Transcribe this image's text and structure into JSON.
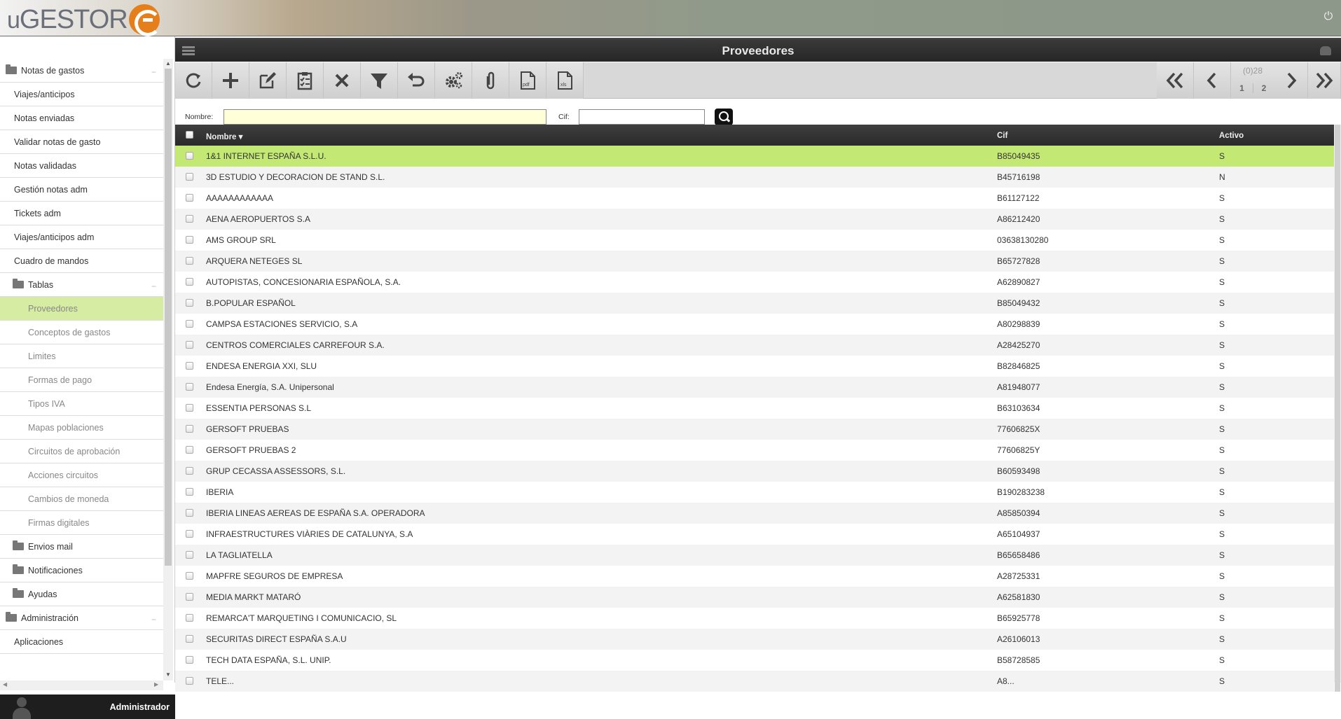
{
  "header": {
    "logo_text": "GESTOR",
    "logo_prefix": "u"
  },
  "sidebar": {
    "items": [
      {
        "label": "Notas de gastos",
        "level": "lvl0",
        "folder": true,
        "collapsible": true
      },
      {
        "label": "Viajes/anticipos",
        "level": "lvl1"
      },
      {
        "label": "Notas enviadas",
        "level": "lvl1"
      },
      {
        "label": "Validar notas de gasto",
        "level": "lvl1"
      },
      {
        "label": "Notas validadas",
        "level": "lvl1"
      },
      {
        "label": "Gestión notas adm",
        "level": "lvl1"
      },
      {
        "label": "Tickets adm",
        "level": "lvl1"
      },
      {
        "label": "Viajes/anticipos adm",
        "level": "lvl1"
      },
      {
        "label": "Cuadro de mandos",
        "level": "lvl1"
      },
      {
        "label": "Tablas",
        "level": "lvl1f",
        "folder": true,
        "collapsible": true
      },
      {
        "label": "Proveedores",
        "level": "lvl2",
        "active": true
      },
      {
        "label": "Conceptos de gastos",
        "level": "lvl2"
      },
      {
        "label": "Limites",
        "level": "lvl2"
      },
      {
        "label": "Formas de pago",
        "level": "lvl2"
      },
      {
        "label": "Tipos IVA",
        "level": "lvl2"
      },
      {
        "label": "Mapas poblaciones",
        "level": "lvl2"
      },
      {
        "label": "Circuitos de aprobación",
        "level": "lvl2"
      },
      {
        "label": "Acciones circuitos",
        "level": "lvl2"
      },
      {
        "label": "Cambios de moneda",
        "level": "lvl2"
      },
      {
        "label": "Firmas digitales",
        "level": "lvl2"
      },
      {
        "label": "Envios mail",
        "level": "lvl1f",
        "folder": true
      },
      {
        "label": "Notificaciones",
        "level": "lvl1f",
        "folder": true
      },
      {
        "label": "Ayudas",
        "level": "lvl1f",
        "folder": true
      },
      {
        "label": "Administración",
        "level": "lvl0",
        "folder": true,
        "collapsible": true
      },
      {
        "label": "Aplicaciones",
        "level": "lvl1"
      }
    ],
    "user_name": "Administrador"
  },
  "main": {
    "title": "Proveedores",
    "toolbar": [
      {
        "name": "refresh-button",
        "icon": "refresh-icon"
      },
      {
        "name": "add-button",
        "icon": "plus-icon"
      },
      {
        "name": "edit-button",
        "icon": "edit-icon"
      },
      {
        "name": "validate-button",
        "icon": "clipboard-check-icon"
      },
      {
        "name": "delete-button",
        "icon": "close-icon"
      },
      {
        "name": "filter-button",
        "icon": "filter-icon"
      },
      {
        "name": "undo-button",
        "icon": "undo-icon"
      },
      {
        "name": "settings-button",
        "icon": "gears-icon"
      },
      {
        "name": "attach-button",
        "icon": "paperclip-icon"
      },
      {
        "name": "pdf-button",
        "icon": "pdf-icon"
      },
      {
        "name": "xls-button",
        "icon": "xls-icon"
      }
    ],
    "pager": {
      "count": "(0)28",
      "page1": "1",
      "page2": "2"
    },
    "filter": {
      "nombre_label": "Nombre:",
      "nombre_value": "",
      "cif_label": "Cif:",
      "cif_value": ""
    },
    "columns": {
      "nombre": "Nombre",
      "cif": "Cif",
      "activo": "Activo"
    },
    "rows": [
      {
        "nombre": "1&1 INTERNET ESPAÑA S.L.U.",
        "cif": "B85049435",
        "activo": "S",
        "selected": true
      },
      {
        "nombre": "3D ESTUDIO Y DECORACION DE STAND S.L.",
        "cif": "B45716198",
        "activo": "N"
      },
      {
        "nombre": "AAAAAAAAAAAA",
        "cif": "B61127122",
        "activo": "S"
      },
      {
        "nombre": "AENA AEROPUERTOS S.A",
        "cif": "A86212420",
        "activo": "S"
      },
      {
        "nombre": "AMS GROUP SRL",
        "cif": "03638130280",
        "activo": "S"
      },
      {
        "nombre": "ARQUERA NETEGES SL",
        "cif": "B65727828",
        "activo": "S"
      },
      {
        "nombre": "AUTOPISTAS, CONCESIONARIA ESPAÑOLA, S.A.",
        "cif": "A62890827",
        "activo": "S"
      },
      {
        "nombre": "B.POPULAR ESPAÑOL",
        "cif": "B85049432",
        "activo": "S"
      },
      {
        "nombre": "CAMPSA ESTACIONES SERVICIO, S.A",
        "cif": "A80298839",
        "activo": "S"
      },
      {
        "nombre": "CENTROS COMERCIALES CARREFOUR S.A.",
        "cif": "A28425270",
        "activo": "S"
      },
      {
        "nombre": "ENDESA ENERGIA XXI, SLU",
        "cif": "B82846825",
        "activo": "S"
      },
      {
        "nombre": "Endesa Energía, S.A. Unipersonal",
        "cif": "A81948077",
        "activo": "S"
      },
      {
        "nombre": "ESSENTIA PERSONAS S.L",
        "cif": "B63103634",
        "activo": "S"
      },
      {
        "nombre": "GERSOFT PRUEBAS",
        "cif": "77606825X",
        "activo": "S"
      },
      {
        "nombre": "GERSOFT PRUEBAS 2",
        "cif": "77606825Y",
        "activo": "S"
      },
      {
        "nombre": "GRUP CECASSA ASSESSORS, S.L.",
        "cif": "B60593498",
        "activo": "S"
      },
      {
        "nombre": "IBERIA",
        "cif": "B190283238",
        "activo": "S"
      },
      {
        "nombre": "IBERIA LINEAS AEREAS DE ESPAÑA S.A. OPERADORA",
        "cif": "A85850394",
        "activo": "S"
      },
      {
        "nombre": "INFRAESTRUCTURES VIÀRIES DE CATALUNYA, S.A",
        "cif": "A65104937",
        "activo": "S"
      },
      {
        "nombre": "LA TAGLIATELLA",
        "cif": "B65658486",
        "activo": "S"
      },
      {
        "nombre": "MAPFRE SEGUROS DE EMPRESA",
        "cif": "A28725331",
        "activo": "S"
      },
      {
        "nombre": "MEDIA MARKT MATARÓ",
        "cif": "A62581830",
        "activo": "S"
      },
      {
        "nombre": "REMARCA'T MARQUETING I COMUNICACIO, SL",
        "cif": "B65925778",
        "activo": "S"
      },
      {
        "nombre": "SECURITAS DIRECT ESPAÑA S.A.U",
        "cif": "A26106013",
        "activo": "S"
      },
      {
        "nombre": "TECH DATA ESPAÑA, S.L. UNIP.",
        "cif": "B58728585",
        "activo": "S"
      },
      {
        "nombre": "TELE...",
        "cif": "A8...",
        "activo": "S"
      }
    ]
  }
}
